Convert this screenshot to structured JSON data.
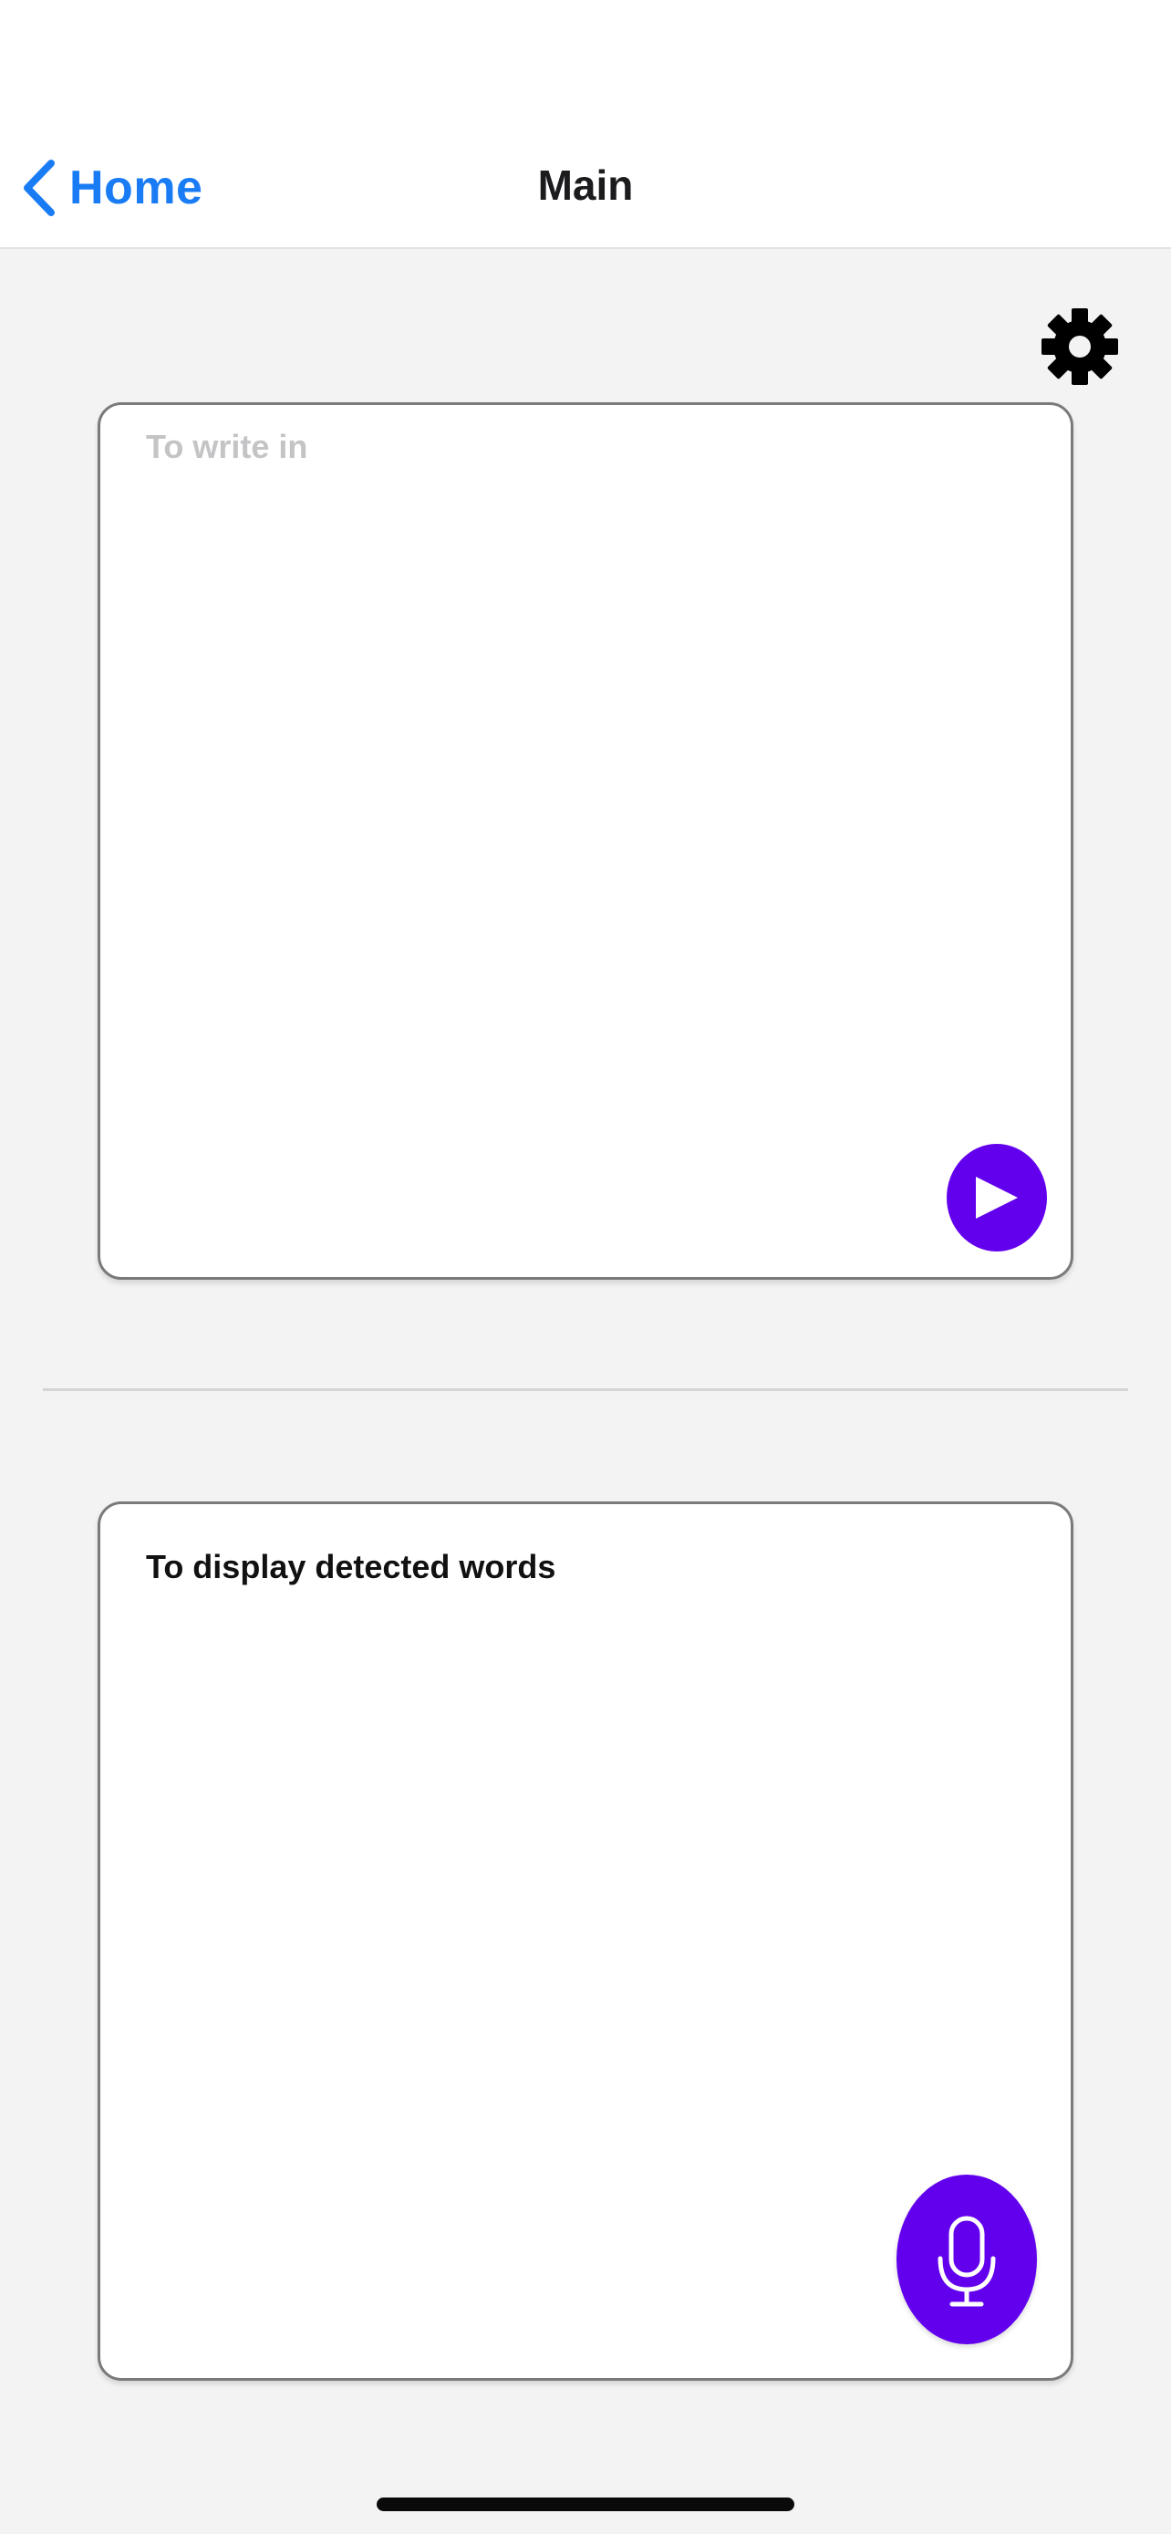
{
  "nav": {
    "back_label": "Home",
    "title": "Main"
  },
  "input_box": {
    "placeholder": "To write in",
    "value": ""
  },
  "output_box": {
    "text": "To display detected words"
  },
  "icons": {
    "back": "chevron-left-icon",
    "settings": "gear-icon",
    "play": "play-icon",
    "mic": "microphone-icon"
  },
  "colors": {
    "accent": "#6200ee",
    "link": "#1a7cf5",
    "background": "#f3f3f3"
  }
}
